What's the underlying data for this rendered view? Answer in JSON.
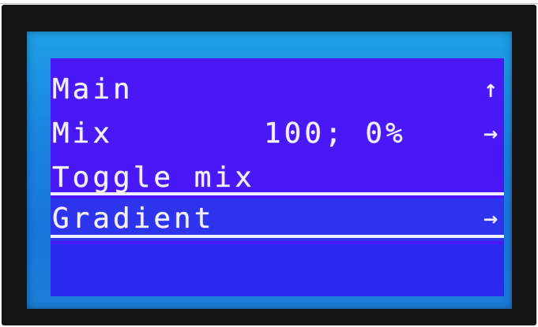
{
  "menu": {
    "items": [
      {
        "label": "Main",
        "value": "",
        "icon": "up-return-arrow-icon",
        "glyph": "↑"
      },
      {
        "label": "Mix",
        "value": "100; 0%",
        "icon": "right-arrow-icon",
        "glyph": "→"
      },
      {
        "label": "Toggle mix",
        "value": "",
        "icon": "",
        "glyph": ""
      },
      {
        "label": "Gradient",
        "value": "",
        "icon": "right-arrow-icon",
        "glyph": "→"
      }
    ],
    "selected_index": 3
  },
  "colors": {
    "screen_bg": "#4a18f7",
    "backlight": "#1a86e0",
    "text": "#f2f2ff"
  }
}
